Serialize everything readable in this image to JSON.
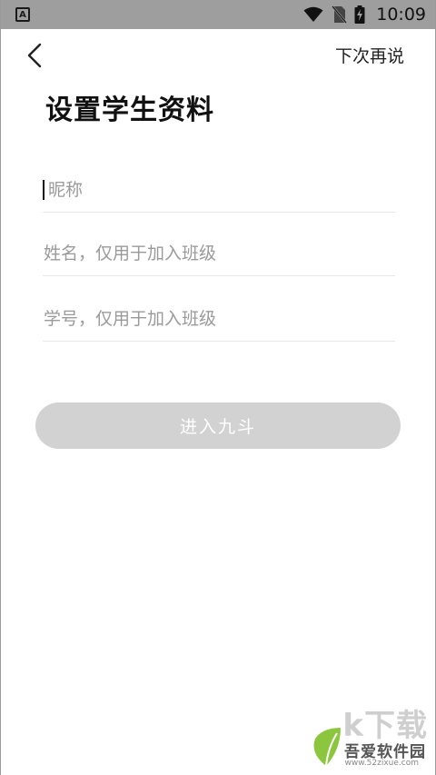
{
  "status_bar": {
    "notification_icon_letter": "A",
    "time": "10:09"
  },
  "header": {
    "skip_label": "下次再说",
    "title": "设置学生资料"
  },
  "form": {
    "nickname_placeholder": "昵称",
    "name_placeholder": "姓名，仅用于加入班级",
    "student_number_placeholder": "学号，仅用于加入班级"
  },
  "actions": {
    "enter_label": "进入九斗"
  },
  "watermark": {
    "big_text": "k下载",
    "site_name": "吾爱软件园",
    "url": "www.52zixue.com"
  },
  "colors": {
    "status_bar_bg": "#9e9e9e",
    "button_disabled_bg": "#d2d2d2",
    "placeholder": "#9a9a9a"
  }
}
